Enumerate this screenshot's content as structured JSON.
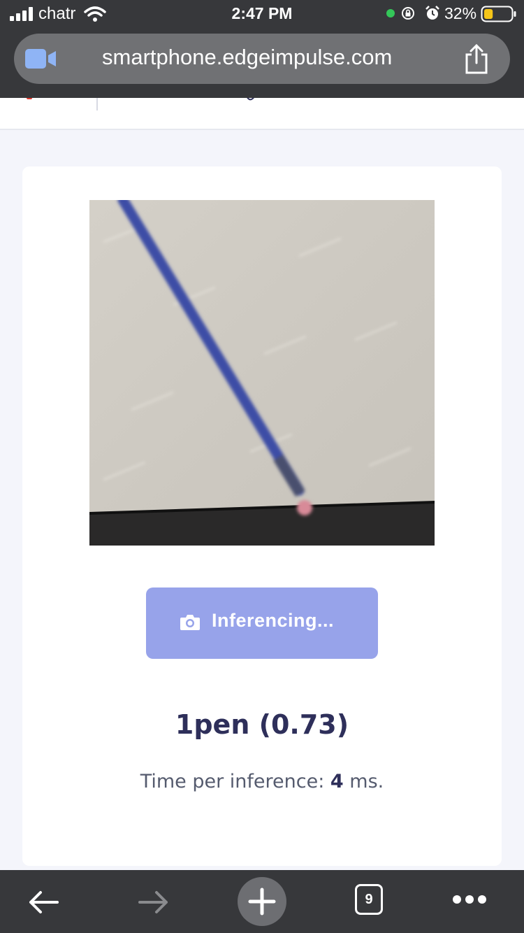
{
  "status_bar": {
    "carrier": "chatr",
    "time": "2:47 PM",
    "battery_percent": "32%",
    "battery_level": 0.32
  },
  "url_bar": {
    "url": "smartphone.edgeimpulse.com"
  },
  "main": {
    "button_label": "Inferencing...",
    "result": "1pen (0.73)",
    "timing_prefix": "Time per inference: ",
    "timing_value": "4",
    "timing_suffix": " ms."
  },
  "toolbar": {
    "tab_count": "9"
  },
  "colors": {
    "chrome": "#37383b",
    "button": "#97a3ea",
    "result_text": "#2e2f5a",
    "page_background": "#f4f5fb"
  },
  "icons": [
    "signal-icon",
    "wifi-icon",
    "lock-rotation-icon",
    "alarm-icon",
    "battery-icon",
    "video-camera-icon",
    "share-icon",
    "camera-icon",
    "back-arrow-icon",
    "forward-arrow-icon",
    "plus-icon",
    "more-dots-icon"
  ]
}
